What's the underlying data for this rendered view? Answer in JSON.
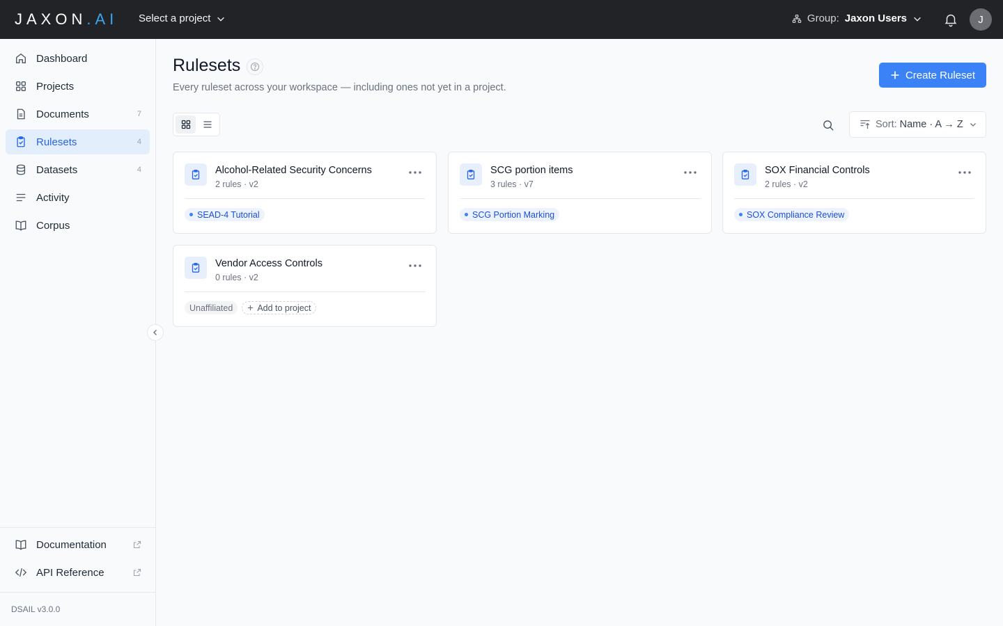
{
  "app": {
    "logo_main": "JAXON",
    "logo_dot": ".",
    "logo_ai": "AI",
    "project_selector": "Select a project",
    "group_label": "Group:",
    "group_name": "Jaxon Users",
    "avatar_initial": "J"
  },
  "sidebar": {
    "items": [
      {
        "label": "Dashboard",
        "icon": "home-icon",
        "count": ""
      },
      {
        "label": "Projects",
        "icon": "grid-icon",
        "count": ""
      },
      {
        "label": "Documents",
        "icon": "document-icon",
        "count": "7"
      },
      {
        "label": "Rulesets",
        "icon": "clipboard-check-icon",
        "count": "4"
      },
      {
        "label": "Datasets",
        "icon": "database-icon",
        "count": "4"
      },
      {
        "label": "Activity",
        "icon": "activity-list-icon",
        "count": ""
      },
      {
        "label": "Corpus",
        "icon": "book-icon",
        "count": ""
      }
    ],
    "bottom_items": [
      {
        "label": "Documentation",
        "icon": "book-icon"
      },
      {
        "label": "API Reference",
        "icon": "code-icon"
      }
    ],
    "version": "DSAIL v3.0.0"
  },
  "page": {
    "title": "Rulesets",
    "subtitle": "Every ruleset across your workspace — including ones not yet in a project.",
    "create_button": "Create Ruleset",
    "sort_label": "Sort:",
    "sort_value": "Name · A → Z"
  },
  "cards": [
    {
      "title": "Alcohol-Related Security Concerns",
      "meta": "2 rules · v2",
      "project": "SEAD-4 Tutorial"
    },
    {
      "title": "SCG portion items",
      "meta": "3 rules · v7",
      "project": "SCG Portion Marking"
    },
    {
      "title": "SOX Financial Controls",
      "meta": "2 rules · v2",
      "project": "SOX Compliance Review"
    },
    {
      "title": "Vendor Access Controls",
      "meta": "0 rules · v2",
      "unaffiliated": "Unaffiliated",
      "add_label": "Add to project"
    }
  ],
  "colors": {
    "topbar": "#222326",
    "accent": "#3b82f6",
    "logo_ai": "#38a7f0",
    "active_nav_bg": "#e3eefd"
  }
}
